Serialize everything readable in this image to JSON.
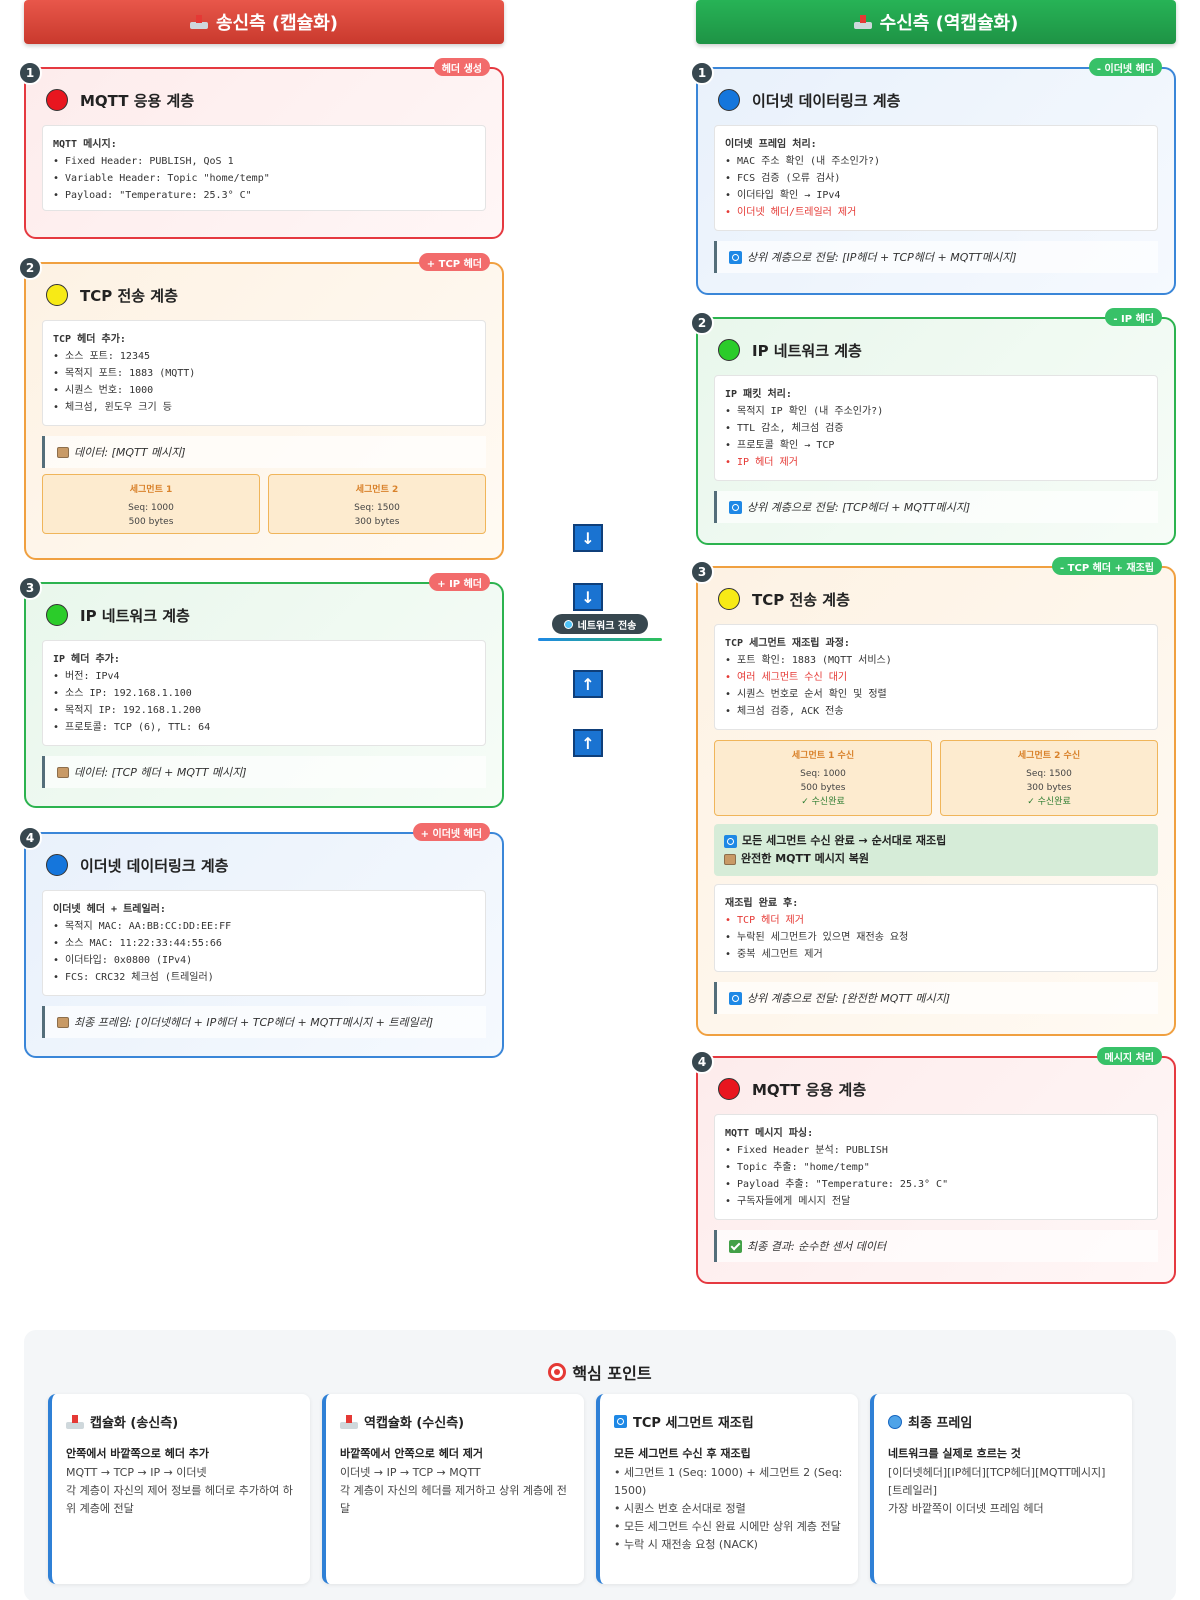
{
  "sender": {
    "header": "송신측 (캡슐화)",
    "layers": [
      {
        "num": "1",
        "title": "MQTT 응용 계층",
        "badge": "헤더 생성",
        "code_head": "MQTT 메시지:",
        "lines": [
          "• Fixed Header: PUBLISH, QoS 1",
          "• Variable Header: Topic \"home/temp\"",
          "• Payload: \"Temperature: 25.3° C\""
        ]
      },
      {
        "num": "2",
        "title": "TCP 전송 계층",
        "badge": "+ TCP 헤더",
        "code_head": "TCP 헤더 추가:",
        "lines": [
          "• 소스 포트: 12345",
          "• 목적지 포트: 1883 (MQTT)",
          "• 시퀀스 번호: 1000",
          "• 체크섬, 윈도우 크기 등"
        ],
        "note": "데이터: [MQTT 메시지]",
        "segments": [
          {
            "title": "세그먼트 1",
            "seq": "Seq: 1000",
            "size": "500 bytes"
          },
          {
            "title": "세그먼트 2",
            "seq": "Seq: 1500",
            "size": "300 bytes"
          }
        ]
      },
      {
        "num": "3",
        "title": "IP 네트워크 계층",
        "badge": "+ IP 헤더",
        "code_head": "IP 헤더 추가:",
        "lines": [
          "• 버전: IPv4",
          "• 소스 IP: 192.168.1.100",
          "• 목적지 IP: 192.168.1.200",
          "• 프로토콜: TCP (6), TTL: 64"
        ],
        "note": "데이터: [TCP 헤더 + MQTT 메시지]"
      },
      {
        "num": "4",
        "title": "이더넷 데이터링크 계층",
        "badge": "+ 이더넷 헤더",
        "code_head": "이더넷 헤더 + 트레일러:",
        "lines": [
          "• 목적지 MAC: AA:BB:CC:DD:EE:FF",
          "• 소스 MAC: 11:22:33:44:55:66",
          "• 이더타입: 0x0800 (IPv4)",
          "• FCS: CRC32 체크섬 (트레일러)"
        ],
        "note": "최종 프레임: [이더넷헤더 + IP헤더 + TCP헤더 + MQTT메시지 + 트레일러]"
      }
    ]
  },
  "receiver": {
    "header": "수신측 (역캡슐화)",
    "layers": [
      {
        "num": "1",
        "title": "이더넷 데이터링크 계층",
        "badge": "- 이더넷 헤더",
        "code_head": "이더넷 프레임 처리:",
        "lines": [
          "• MAC 주소 확인 (내 주소인가?)",
          "• FCS 검증 (오류 검사)",
          "• 이더타입 확인 → IPv4",
          "• 이더넷 헤더/트레일러 제거"
        ],
        "note": "상위 계층으로 전달: [IP헤더 + TCP헤더 + MQTT메시지]"
      },
      {
        "num": "2",
        "title": "IP 네트워크 계층",
        "badge": "- IP 헤더",
        "code_head": "IP 패킷 처리:",
        "lines": [
          "• 목적지 IP 확인 (내 주소인가?)",
          "• TTL 감소, 체크섬 검증",
          "• 프로토콜 확인 → TCP",
          "• IP 헤더 제거"
        ],
        "note": "상위 계층으로 전달: [TCP헤더 + MQTT메시지]"
      },
      {
        "num": "3",
        "title": "TCP 전송 계층",
        "badge": "- TCP 헤더 + 재조립",
        "code_head": "TCP 세그먼트 재조립 과정:",
        "lines": [
          "• 포트 확인: 1883 (MQTT 서비스)",
          "• 여러 세그먼트 수신 대기",
          "• 시퀀스 번호로 순서 확인 및 정렬",
          "• 체크섬 검증, ACK 전송"
        ],
        "segments": [
          {
            "title": "세그먼트 1 수신",
            "seq": "Seq: 1000",
            "size": "500 bytes",
            "status": "✓ 수신완료"
          },
          {
            "title": "세그먼트 2 수신",
            "seq": "Seq: 1500",
            "size": "300 bytes",
            "status": "✓ 수신완료"
          }
        ],
        "assembled": [
          "모든 세그먼트 수신 완료 → 순서대로 재조립",
          "완전한 MQTT 메시지 복원"
        ],
        "code2_head": "재조립 완료 후:",
        "lines2": [
          "• TCP 헤더 제거",
          "• 누락된 세그먼트가 있으면 재전송 요청",
          "• 중복 세그먼트 제거"
        ],
        "note": "상위 계층으로 전달: [완전한 MQTT 메시지]"
      },
      {
        "num": "4",
        "title": "MQTT 응용 계층",
        "badge": "메시지 처리",
        "code_head": "MQTT 메시지 파싱:",
        "lines": [
          "• Fixed Header 분석: PUBLISH",
          "• Topic 추출: \"home/temp\"",
          "• Payload 추출: \"Temperature: 25.3° C\"",
          "• 구독자들에게 메시지 전달"
        ],
        "note": "최종 결과: 순수한 센서 데이터"
      }
    ]
  },
  "middle": {
    "down_arrow": "↓",
    "up_arrow": "↑",
    "network_label": "네트워크 전송"
  },
  "points": {
    "title": "핵심 포인트",
    "cards": [
      {
        "title": "캡슐화 (송신측)",
        "subtitle": "안쪽에서 바깥쪽으로 헤더 추가",
        "lines": [
          "MQTT → TCP → IP → 이더넷",
          "각 계층이 자신의 제어 정보를 헤더로 추가하여 하위 계층에 전달"
        ]
      },
      {
        "title": "역캡슐화 (수신측)",
        "subtitle": "바깥쪽에서 안쪽으로 헤더 제거",
        "lines": [
          "이더넷 → IP → TCP → MQTT",
          "각 계층이 자신의 헤더를 제거하고 상위 계층에 전달"
        ]
      },
      {
        "title": "TCP 세그먼트 재조립",
        "subtitle": "모든 세그먼트 수신 후 재조립",
        "lines": [
          "• 세그먼트 1 (Seq: 1000) + 세그먼트 2 (Seq: 1500)",
          "• 시퀀스 번호 순서대로 정렬",
          "• 모든 세그먼트 수신 완료 시에만 상위 계층 전달",
          "• 누락 시 재전송 요청 (NACK)"
        ]
      },
      {
        "title": "최종 프레임",
        "subtitle": "네트워크를 실제로 흐르는 것",
        "lines": [
          "[이더넷헤더][IP헤더][TCP헤더][MQTT메시지][트레일러]",
          "가장 바깥쪽이 이더넷 프레임 헤더"
        ]
      }
    ]
  }
}
